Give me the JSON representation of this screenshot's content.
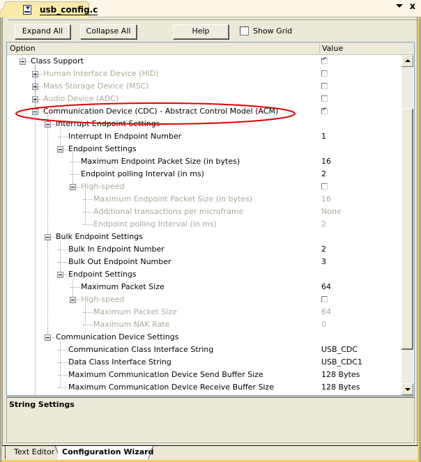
{
  "file_tab": {
    "label": "usb_config.c",
    "icon": "c-source-file-icon"
  },
  "tab_controls": {
    "menu_icon": "dropdown-arrow-icon",
    "close_icon": "close-icon",
    "close_glyph": "x"
  },
  "toolbar": {
    "expand_all": "Expand All",
    "collapse_all": "Collapse All",
    "help": "Help",
    "show_grid": "Show Grid",
    "show_grid_checked": false
  },
  "grid": {
    "columns": {
      "option": "Option",
      "value": "Value"
    },
    "rows": [
      {
        "label": "Class Support",
        "value_type": "checkbox",
        "checked": true,
        "enabled": true,
        "level": 1,
        "expander": "minus"
      },
      {
        "label": "Human Interface Device (HID)",
        "value_type": "checkbox",
        "checked": false,
        "enabled": false,
        "level": 2,
        "expander": "plus"
      },
      {
        "label": "Mass Storage Device (MSC)",
        "value_type": "checkbox",
        "checked": false,
        "enabled": false,
        "level": 2,
        "expander": "plus"
      },
      {
        "label": "Audio Device (ADC)",
        "value_type": "checkbox",
        "checked": false,
        "enabled": false,
        "level": 2,
        "expander": "plus"
      },
      {
        "label": "Communication Device (CDC) - Abstract Control Model (ACM)",
        "value_type": "checkbox",
        "checked": true,
        "enabled": true,
        "level": 2,
        "expander": "minus",
        "highlighted": true
      },
      {
        "label": "Interrupt Endpoint Settings",
        "value_type": "none",
        "enabled": true,
        "level": 3,
        "expander": "minus"
      },
      {
        "label": "Interrupt In Endpoint Number",
        "value_type": "text",
        "value": "1",
        "enabled": true,
        "level": 4
      },
      {
        "label": "Endpoint Settings",
        "value_type": "none",
        "enabled": true,
        "level": 4,
        "expander": "minus"
      },
      {
        "label": "Maximum Endpoint Packet Size (in bytes)",
        "value_type": "text",
        "value": "16",
        "enabled": true,
        "level": 5
      },
      {
        "label": "Endpoint polling Interval (in ms)",
        "value_type": "text",
        "value": "2",
        "enabled": true,
        "level": 5
      },
      {
        "label": "High-speed",
        "value_type": "checkbox",
        "checked": false,
        "enabled": false,
        "level": 5,
        "expander": "minus"
      },
      {
        "label": "Maximum Endpoint Packet Size (in bytes)",
        "value_type": "text",
        "value": "16",
        "enabled": false,
        "level": 6
      },
      {
        "label": "Additional transactions per microframe",
        "value_type": "text",
        "value": "None",
        "enabled": false,
        "level": 6
      },
      {
        "label": "Endpoint polling Interval (in ms)",
        "value_type": "text",
        "value": "2",
        "enabled": false,
        "level": 6
      },
      {
        "label": "Bulk Endpoint Settings",
        "value_type": "none",
        "enabled": true,
        "level": 3,
        "expander": "minus"
      },
      {
        "label": "Bulk In Endpoint Number",
        "value_type": "text",
        "value": "2",
        "enabled": true,
        "level": 4
      },
      {
        "label": "Bulk Out Endpoint Number",
        "value_type": "text",
        "value": "3",
        "enabled": true,
        "level": 4
      },
      {
        "label": "Endpoint Settings",
        "value_type": "none",
        "enabled": true,
        "level": 4,
        "expander": "minus"
      },
      {
        "label": "Maximum Packet Size",
        "value_type": "text",
        "value": "64",
        "enabled": true,
        "level": 5
      },
      {
        "label": "High-speed",
        "value_type": "checkbox",
        "checked": false,
        "enabled": false,
        "level": 5,
        "expander": "minus"
      },
      {
        "label": "Maximum Packet Size",
        "value_type": "text",
        "value": "64",
        "enabled": false,
        "level": 6
      },
      {
        "label": "Maximum NAK Rate",
        "value_type": "text",
        "value": "0",
        "enabled": false,
        "level": 6
      },
      {
        "label": "Communication Device Settings",
        "value_type": "none",
        "enabled": true,
        "level": 3,
        "expander": "minus"
      },
      {
        "label": "Communication Class Interface String",
        "value_type": "text",
        "value": "USB_CDC",
        "enabled": true,
        "level": 4
      },
      {
        "label": "Data Class Interface String",
        "value_type": "text",
        "value": "USB_CDC1",
        "enabled": true,
        "level": 4
      },
      {
        "label": "Maximum Communication Device Send Buffer Size",
        "value_type": "text",
        "value": "128 Bytes",
        "enabled": true,
        "level": 4
      },
      {
        "label": "Maximum Communication Device Receive Buffer Size",
        "value_type": "text",
        "value": "128 Bytes",
        "enabled": true,
        "level": 4
      }
    ]
  },
  "description": {
    "title": "String Settings"
  },
  "bottom_tabs": [
    {
      "label": "Text Editor",
      "active": false
    },
    {
      "label": "Configuration Wizard",
      "active": true
    }
  ],
  "colors": {
    "disabled_text": "#aca899",
    "annotation": "#e00000",
    "tab_active": "#fde9a8"
  }
}
